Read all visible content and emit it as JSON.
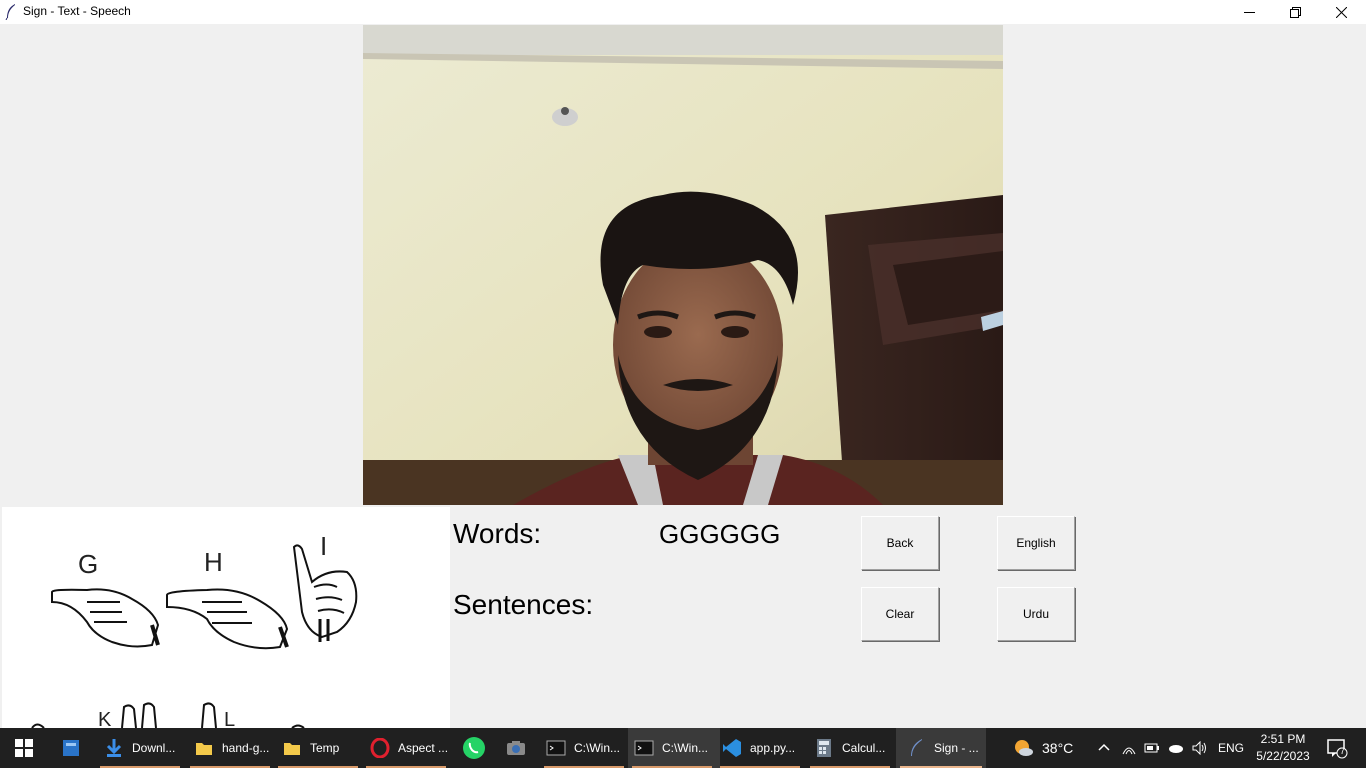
{
  "window": {
    "title": "Sign - Text - Speech",
    "controls": [
      "minimize",
      "restore",
      "close"
    ]
  },
  "sign_chart": {
    "letters": [
      "G",
      "H",
      "I",
      "K",
      "L"
    ]
  },
  "words": {
    "label": "Words:",
    "value": "GGGGGG"
  },
  "sentences": {
    "label": "Sentences:",
    "value": ""
  },
  "buttons": {
    "back": "Back",
    "english": "English",
    "clear": "Clear",
    "urdu": "Urdu"
  },
  "taskbar": {
    "items": [
      {
        "icon": "windows-start-icon",
        "label": ""
      },
      {
        "icon": "widgets-icon",
        "label": ""
      },
      {
        "icon": "download-icon",
        "label": "Downl..."
      },
      {
        "icon": "folder-icon",
        "label": "hand-g..."
      },
      {
        "icon": "folder-icon",
        "label": "Temp"
      },
      {
        "icon": "opera-icon",
        "label": "Aspect ..."
      },
      {
        "icon": "whatsapp-icon",
        "label": ""
      },
      {
        "icon": "camera-icon",
        "label": ""
      },
      {
        "icon": "terminal-icon",
        "label": "C:\\Win..."
      },
      {
        "icon": "terminal-icon",
        "label": "C:\\Win..."
      },
      {
        "icon": "vscode-icon",
        "label": "app.py..."
      },
      {
        "icon": "calculator-icon",
        "label": "Calcul..."
      },
      {
        "icon": "feather-icon",
        "label": "Sign - ..."
      }
    ],
    "weather": "38°C",
    "language": "ENG",
    "time": "2:51 PM",
    "date": "5/22/2023",
    "notifications": "7"
  },
  "colors": {
    "taskbar_bg": "#202020",
    "window_bg": "#f0f0f0",
    "accent_underline": "#d89a6a"
  }
}
